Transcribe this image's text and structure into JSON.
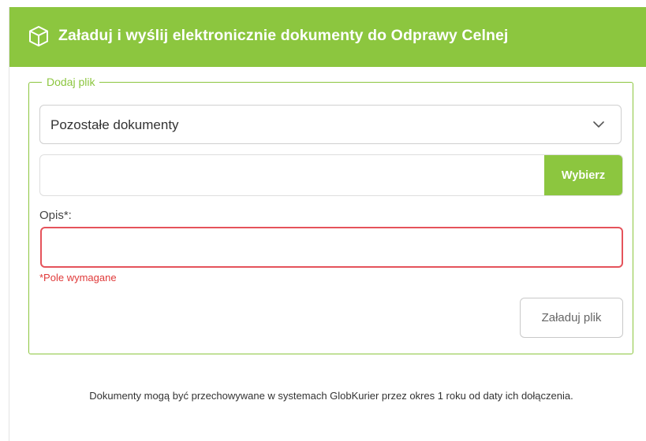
{
  "header": {
    "title": "Załaduj i wyślij elektronicznie dokumenty do Odprawy Celnej",
    "icon": "cube-icon",
    "background": "#8cc63f"
  },
  "form": {
    "legend": "Dodaj plik",
    "document_type": {
      "selected": "Pozostałe dokumenty",
      "icon": "chevron-down-icon"
    },
    "file": {
      "choose_label": "Wybierz"
    },
    "description": {
      "label": "Opis*:",
      "value": "",
      "error": "*Pole wymagane"
    },
    "upload_label": "Załaduj plik"
  },
  "footnote": "Dokumenty mogą być przechowywane w systemach GlobKurier przez okres 1 roku od daty ich dołączenia.",
  "colors": {
    "accent": "#8cc63f",
    "error": "#e5535b"
  }
}
